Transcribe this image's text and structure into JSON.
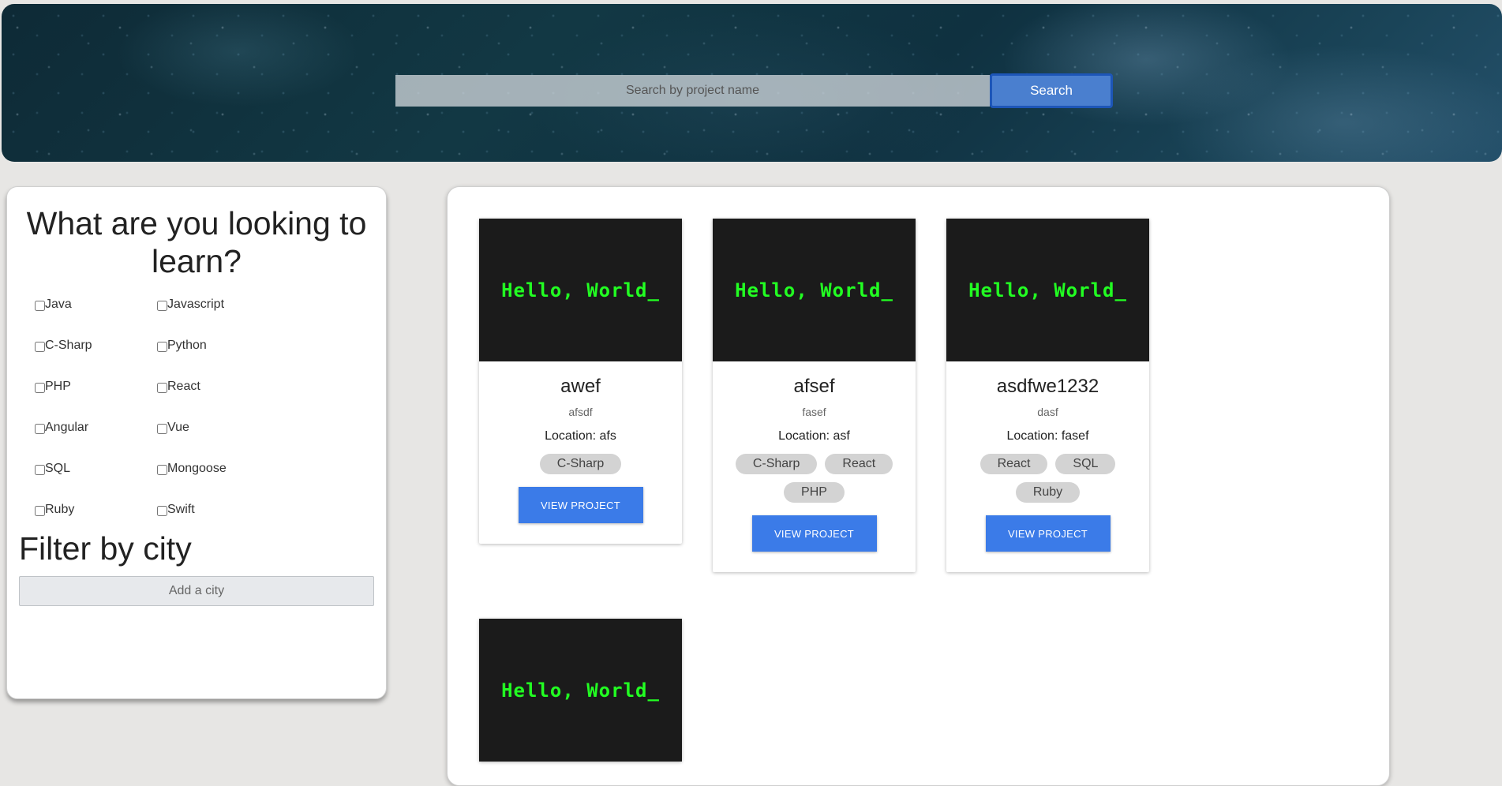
{
  "search": {
    "placeholder": "Search by project name",
    "button_label": "Search"
  },
  "sidebar": {
    "title": "What are you looking to learn?",
    "languages": [
      [
        "Java",
        "Javascript"
      ],
      [
        "C-Sharp",
        "Python"
      ],
      [
        "PHP",
        "React"
      ],
      [
        "Angular",
        "Vue"
      ],
      [
        "SQL",
        "Mongoose"
      ],
      [
        "Ruby",
        "Swift"
      ]
    ],
    "city_title": "Filter by city",
    "city_placeholder": "Add a city"
  },
  "projects": [
    {
      "image_text": "Hello, World_",
      "title": "awef",
      "description": "afsdf",
      "location": "Location: afs",
      "tags": [
        "C-Sharp"
      ],
      "button_label": "VIEW PROJECT"
    },
    {
      "image_text": "Hello, World_",
      "title": "afsef",
      "description": "fasef",
      "location": "Location: asf",
      "tags": [
        "C-Sharp",
        "React",
        "PHP"
      ],
      "button_label": "VIEW PROJECT"
    },
    {
      "image_text": "Hello, World_",
      "title": "asdfwe1232",
      "description": "dasf",
      "location": "Location: fasef",
      "tags": [
        "React",
        "SQL",
        "Ruby"
      ],
      "button_label": "VIEW PROJECT"
    },
    {
      "image_text": "Hello, World_"
    }
  ],
  "colors": {
    "accent_button": "#3b7be8",
    "search_button": "#4a7fcf",
    "card_image_bg": "#1b1b1b",
    "card_image_text": "#22ff22",
    "tag_bg": "#d3d3d3",
    "page_bg": "#e7e6e4"
  }
}
